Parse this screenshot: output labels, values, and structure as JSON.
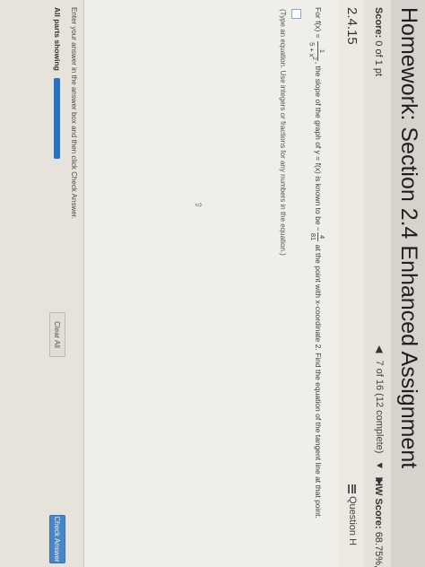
{
  "header": {
    "title": "Homework: Section 2.4 Enhanced Assignment"
  },
  "scorebar": {
    "score_label": "Score:",
    "score_value": "0 of 1 pt",
    "prev_icon": "triangle-left",
    "progress_text": "7 of 16 (12 complete)",
    "dropdown_icon": "triangle-down",
    "next_icon": "triangle-right",
    "hw_label": "HW Score:",
    "hw_value": "68.75%, 1"
  },
  "section": {
    "number": "2.4.15",
    "help_icon": "grid-icon",
    "help_label": "Question H"
  },
  "problem": {
    "text_before": "For f(x) = ",
    "f_num": "1",
    "f_den": "5 + x",
    "f_den_exp": "2",
    "text_middle": ", the slope of the graph of y = f(x) is known to be −",
    "slope_num": "4",
    "slope_den": "81",
    "text_after": " at the point with x-coordinate 2. Find the equation of the tangent line at that point.",
    "hint": "(Type an equation. Use integers or fractions for any numbers in the equation.)",
    "cursor_icon": "pointer-cursor-icon"
  },
  "footer": {
    "instructions": "Enter your answer in the answer box and then click Check Answer.",
    "parts_label": "All parts showing",
    "parts_fraction": 1.0,
    "clear_label": "Clear All",
    "check_label": "Check Answer"
  },
  "colors": {
    "accent": "#2f6fb5",
    "check_button": "#4b86c4"
  }
}
